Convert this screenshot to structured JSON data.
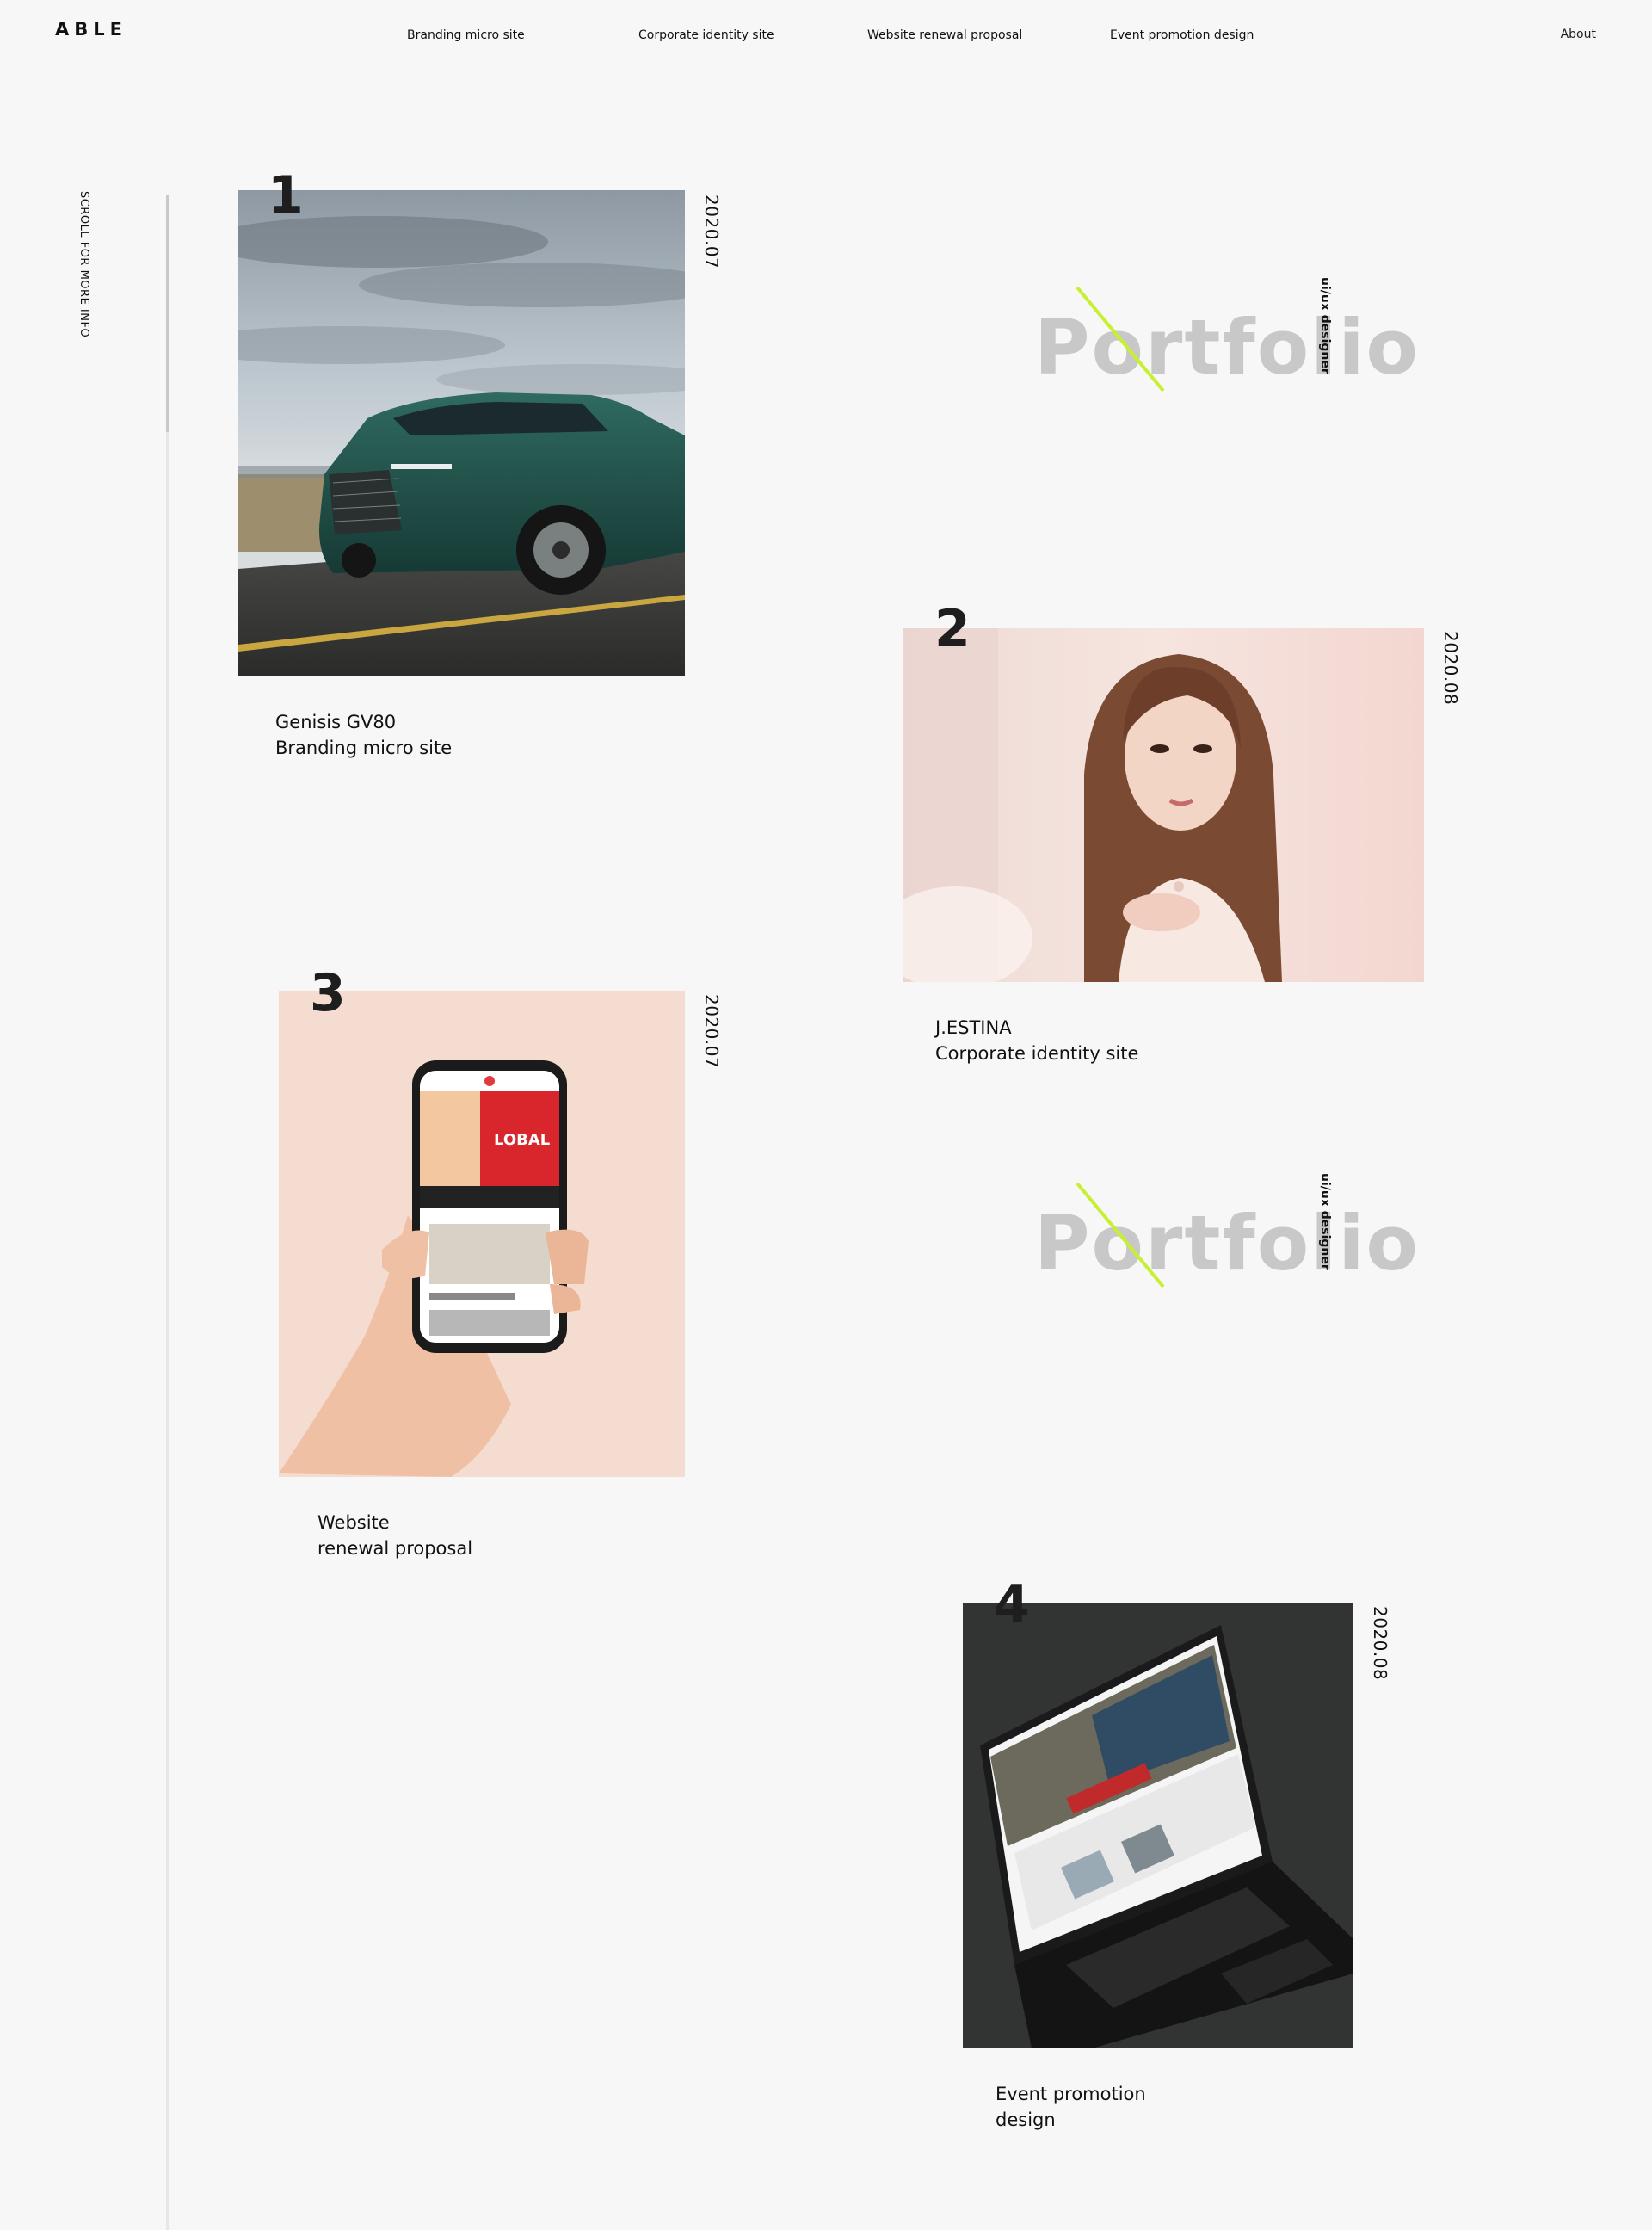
{
  "header": {
    "logo": "ABLE",
    "nav": [
      "Branding micro site",
      "Corporate identity site",
      "Website renewal proposal",
      "Event promotion design"
    ],
    "about": "About"
  },
  "sidebar": {
    "scroll_hint": "SCROLL FOR MORE INFO"
  },
  "portfolio_mark": {
    "word": "Portfolio",
    "subtitle": "ui/ux designer",
    "accent": "#c8f032"
  },
  "cards": [
    {
      "number": "1",
      "date": "2020.07",
      "title_line1": "Genisis GV80",
      "title_line2": "Branding micro site"
    },
    {
      "number": "2",
      "date": "2020.08",
      "title_line1": "J.ESTINA",
      "title_line2": "Corporate identity site"
    },
    {
      "number": "3",
      "date": "2020.07",
      "title_line1": "Website",
      "title_line2": "renewal proposal"
    },
    {
      "number": "4",
      "date": "2020.08",
      "title_line1": "Event promotion",
      "title_line2": "design"
    }
  ],
  "colors": {
    "background": "#f7f7f7",
    "text": "#111111",
    "portfolio_gray": "#c8c8c8"
  }
}
